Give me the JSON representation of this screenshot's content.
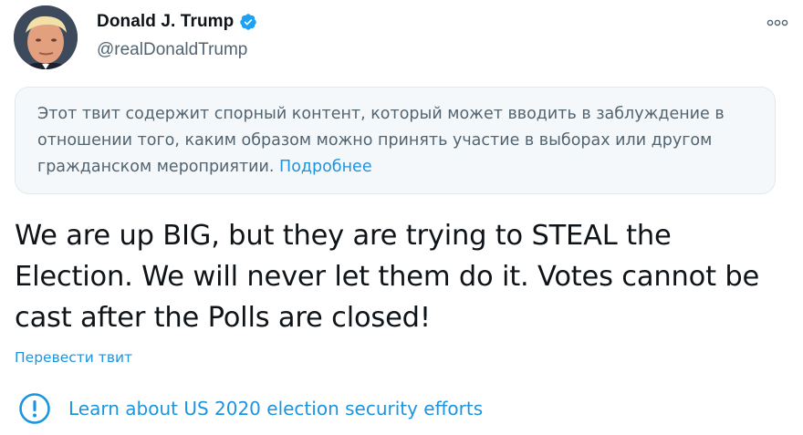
{
  "author": {
    "display_name": "Donald J. Trump",
    "handle": "@realDonaldTrump",
    "verified": true,
    "avatar_icon": "profile-photo"
  },
  "more_icon": "more-horizontal-icon",
  "notice": {
    "text": "Этот твит содержит спорный контент, который может вводить в заблуждение в отношении того, каким образом можно принять участие в выборах или другом гражданском мероприятии.",
    "link_label": "Подробнее"
  },
  "tweet": {
    "text": "We are up BIG, but they are trying to STEAL the Election. We will never let them do it. Votes cannot be cast after the Polls are closed!",
    "translate_label": "Перевести твит"
  },
  "learn_more": {
    "icon": "alert-circle-icon",
    "label": "Learn about US 2020 election security efforts"
  },
  "colors": {
    "accent": "#1b95e0",
    "verified": "#1da1f2",
    "secondary_text": "#536471",
    "notice_bg": "#f5f8fa"
  }
}
